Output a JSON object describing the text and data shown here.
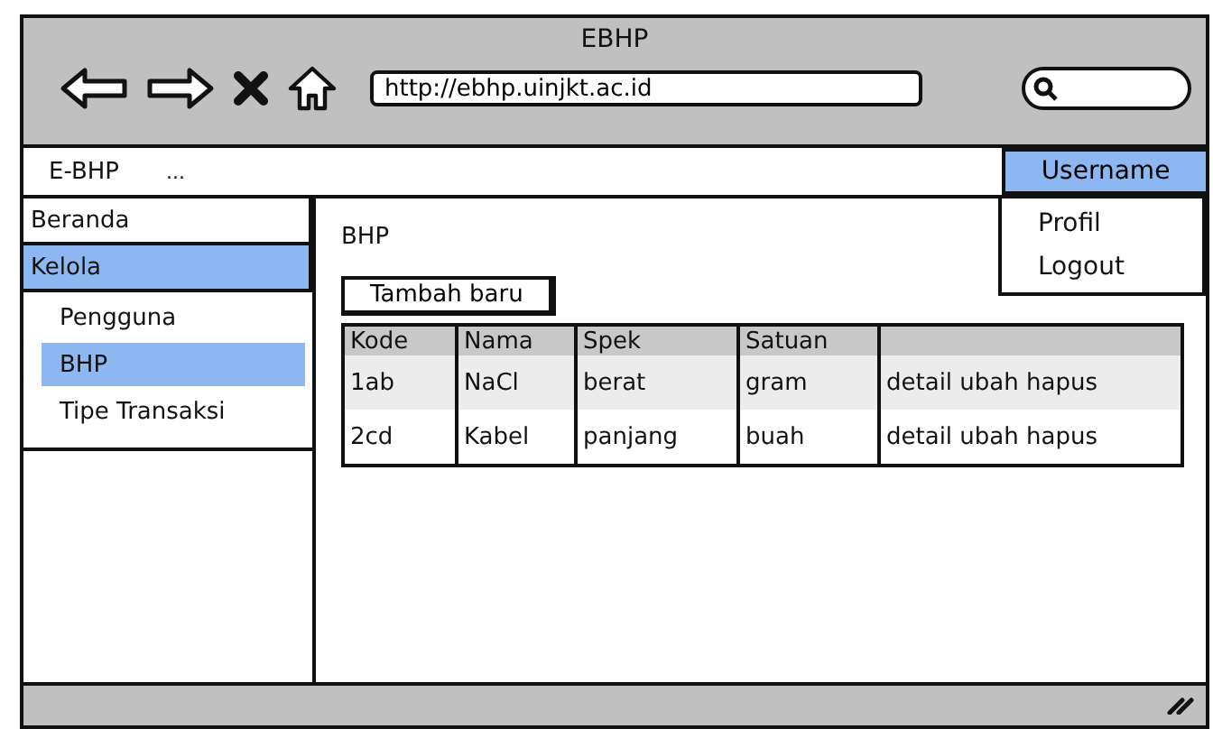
{
  "window": {
    "title": "EBHP"
  },
  "address_bar": {
    "value": "http://ebhp.uinjkt.ac.id"
  },
  "menubar": {
    "brand": "E-BHP",
    "more": "...",
    "user_menu": {
      "label": "Username",
      "expanded": true,
      "items": [
        "Profil",
        "Logout"
      ]
    }
  },
  "sidebar": {
    "items": [
      {
        "label": "Beranda",
        "selected": false
      },
      {
        "label": "Kelola",
        "selected": true,
        "children": [
          {
            "label": "Pengguna",
            "selected": false
          },
          {
            "label": "BHP",
            "selected": true
          },
          {
            "label": "Tipe Transaksi",
            "selected": false
          }
        ]
      }
    ]
  },
  "content": {
    "heading": "BHP",
    "add_button": "Tambah baru",
    "table": {
      "columns": [
        "Kode",
        "Nama",
        "Spek",
        "Satuan"
      ],
      "rows": [
        [
          "1ab",
          "NaCl",
          "berat",
          "gram",
          "detail ubah hapus"
        ],
        [
          "2cd",
          "Kabel",
          "panjang",
          "buah",
          "detail ubah hapus"
        ]
      ]
    }
  }
}
